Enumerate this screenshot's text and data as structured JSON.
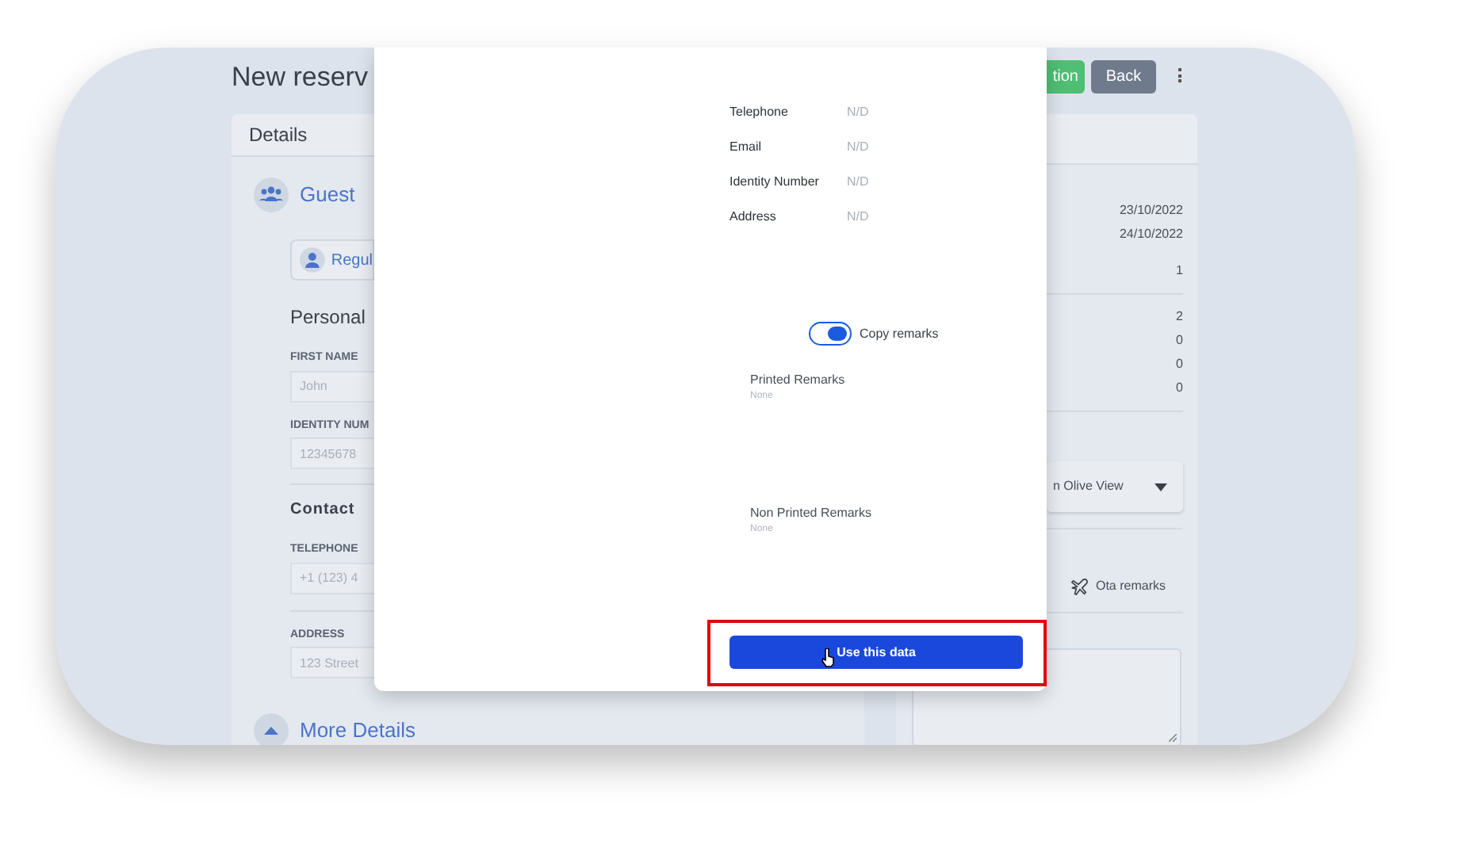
{
  "page": {
    "title": "New reserv",
    "buttons": [
      {
        "label": "tion",
        "kind": "primary"
      },
      {
        "label": "Back",
        "kind": "secondary"
      }
    ]
  },
  "details_card": {
    "title": "Details",
    "guest_heading": "Guest",
    "guest_type_button": "Regul",
    "personal_heading": "Personal",
    "personal_fields": [
      {
        "label": "FIRST NAME",
        "placeholder": "John"
      },
      {
        "label": "IDENTITY NUM",
        "placeholder": "12345678"
      }
    ],
    "contact_heading": "Contact",
    "contact_fields": [
      {
        "label": "TELEPHONE",
        "placeholder": "+1 (123) 4"
      },
      {
        "label": "ADDRESS",
        "placeholder": "123 Street"
      }
    ],
    "more_details_heading": "More Details"
  },
  "summary_card": {
    "dates": [
      "23/10/2022",
      "24/10/2022"
    ],
    "nights": "1",
    "counts": [
      "2",
      "0",
      "0",
      "0"
    ],
    "room_select": "n Olive View",
    "tab": "Ota remarks"
  },
  "modal": {
    "info_rows": [
      {
        "label": "Telephone",
        "value": "N/D"
      },
      {
        "label": "Email",
        "value": "N/D"
      },
      {
        "label": "Identity Number",
        "value": "N/D"
      },
      {
        "label": "Address",
        "value": "N/D"
      }
    ],
    "copy_remarks": {
      "label": "Copy remarks",
      "on": true
    },
    "remarks": [
      {
        "title": "Printed Remarks",
        "value": "None"
      },
      {
        "title": "Non Printed Remarks",
        "value": "None"
      }
    ],
    "action_button": "Use this data"
  }
}
